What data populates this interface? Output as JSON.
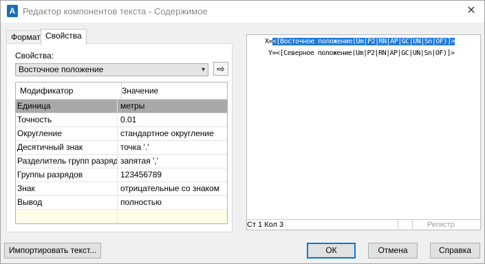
{
  "window": {
    "title": "Редактор компонентов текста - Содержимое",
    "close_glyph": "✕",
    "app_icon_letter": "A"
  },
  "tabs": [
    {
      "label": "Формат",
      "active": false
    },
    {
      "label": "Свойства",
      "active": true
    }
  ],
  "properties": {
    "label": "Свойства:",
    "selected": "Восточное положение",
    "transfer_glyph": "⇨"
  },
  "grid": {
    "headers": [
      "Модификатор",
      "Значение"
    ],
    "rows": [
      {
        "name": "Единица",
        "value": "метры",
        "selected": true
      },
      {
        "name": "Точность",
        "value": "0.01"
      },
      {
        "name": "Округление",
        "value": "стандартное округление"
      },
      {
        "name": "Десятичный знак",
        "value": "точка '.'"
      },
      {
        "name": "Разделитель групп разряд",
        "value": "запятая ','"
      },
      {
        "name": "Группы разрядов",
        "value": "123456789"
      },
      {
        "name": "Знак",
        "value": "отрицательные со знаком"
      },
      {
        "name": "Вывод",
        "value": "полностью"
      }
    ]
  },
  "preview": {
    "line1_prefix": "X=",
    "line1_highlight": "<[Восточное положение(Um|P2|RN|AP|GC|UN|Sn|OF)]>",
    "line2": "Y=<[Северное положение(Um|P2|RN|AP|GC|UN|Sn|OF)]>",
    "status_position": "Ст 1 Кол 3",
    "register_label": "Регистр"
  },
  "buttons": {
    "import": "Импортировать текст...",
    "ok": "ОК",
    "cancel": "Отмена",
    "help": "Справка"
  },
  "colors": {
    "selection_highlight": "#1e7ad8",
    "selected_row": "#a9a9a9",
    "empty_row": "#fffde8"
  }
}
